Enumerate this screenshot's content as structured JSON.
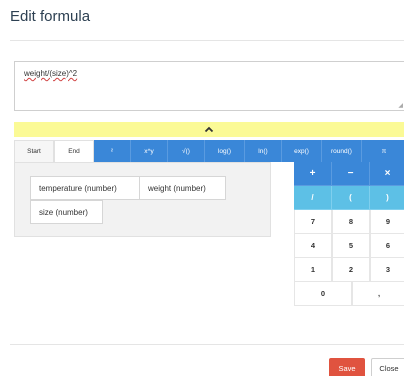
{
  "dialog": {
    "title": "Edit formula"
  },
  "formula": {
    "value": "weight/(size)^2"
  },
  "collapse_bar": {
    "icon": "chevron-up-icon",
    "color": "#fbfa96"
  },
  "tabs": {
    "start": "Start",
    "end": "End"
  },
  "functions": [
    "²",
    "x^y",
    "√()",
    "log()",
    "ln()",
    "exp()",
    "round()",
    "π"
  ],
  "variables": [
    "temperature (number)",
    "weight (number)",
    "size (number)"
  ],
  "keypad": {
    "operators": [
      "+",
      "−",
      "×"
    ],
    "brackets": [
      "/",
      "(",
      ")"
    ],
    "digits": [
      "7",
      "8",
      "9",
      "4",
      "5",
      "6",
      "1",
      "2",
      "3"
    ],
    "zero": "0",
    "comma": ","
  },
  "footer": {
    "save_label": "Save",
    "close_label": "Close"
  },
  "colors": {
    "accent": "#3a87d8",
    "secondary": "#5dc0e6",
    "save": "#e0533f"
  }
}
